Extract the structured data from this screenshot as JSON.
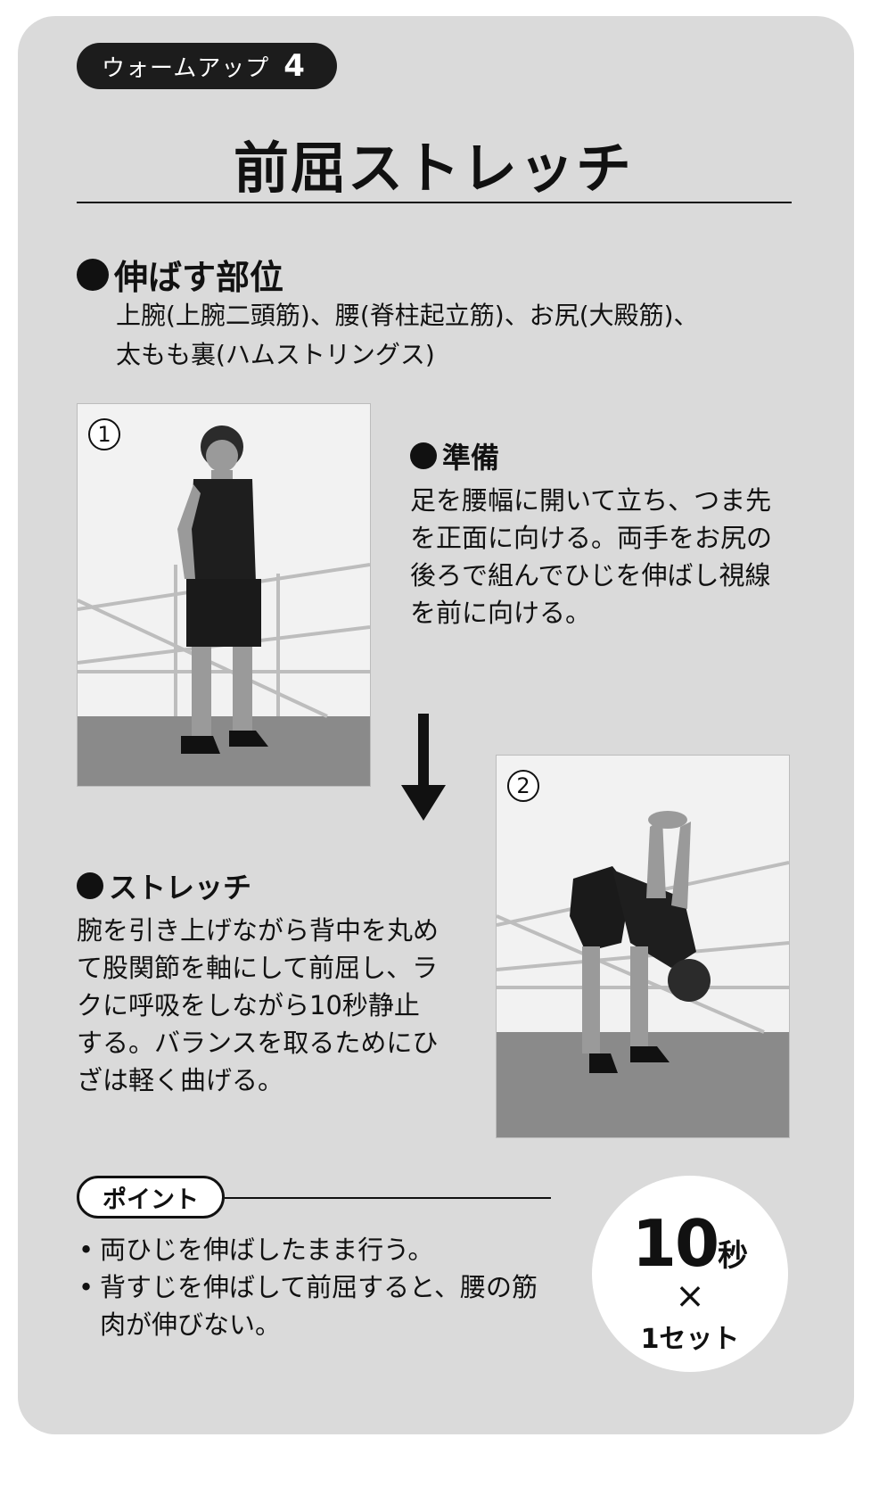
{
  "badge": {
    "label": "ウォームアップ",
    "number": "4"
  },
  "title": "前屈ストレッチ",
  "targets": {
    "heading": "伸ばす部位",
    "text": "上腕(上腕二頭筋)、腰(脊柱起立筋)、お尻(大殿筋)、\n太もも裏(ハムストリングス)"
  },
  "steps": [
    {
      "number": "1",
      "heading": "準備",
      "text": "足を腰幅に開いて立ち、つま先\nを正面に向ける。両手をお尻の\n後ろで組んでひじを伸ばし視線\nを前に向ける。"
    },
    {
      "number": "2",
      "heading": "ストレッチ",
      "text": "腕を引き上げながら背中を丸め\nて股関節を軸にして前屈し、ラ\nクに呼吸をしながら10秒静止\nする。バランスを取るためにひ\nざは軽く曲げる。"
    }
  ],
  "point": {
    "label": "ポイント",
    "items": [
      "両ひじを伸ばしたまま行う。",
      "背すじを伸ばして前屈すると、腰の筋肉が伸びない。"
    ]
  },
  "reps": {
    "seconds": "10",
    "unit": "秒",
    "times": "×",
    "sets": "1セット"
  }
}
